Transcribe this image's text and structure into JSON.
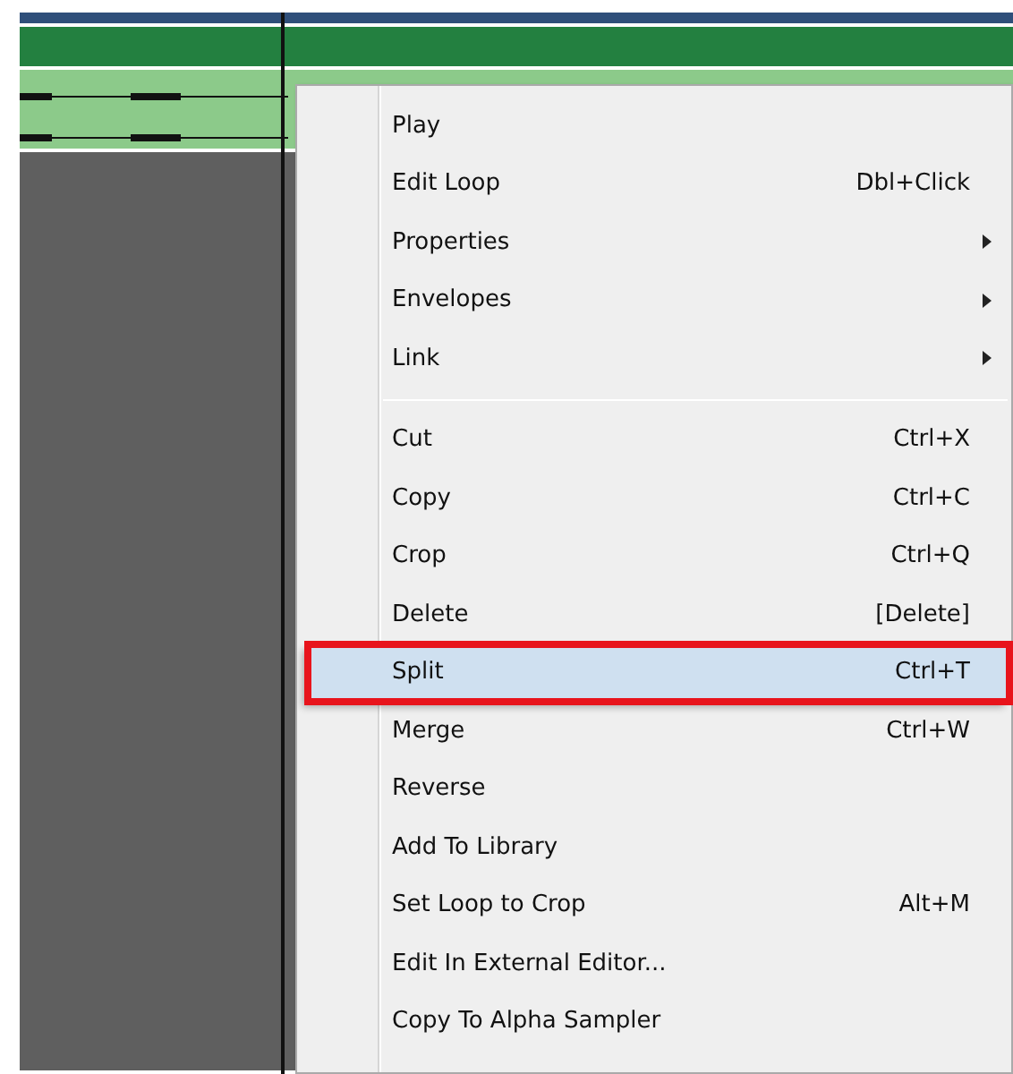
{
  "context_menu": {
    "items": [
      {
        "kind": "item",
        "label": "Play",
        "selected": false
      },
      {
        "kind": "item",
        "label": "Edit Loop",
        "shortcut": "Dbl+Click",
        "selected": false
      },
      {
        "kind": "item",
        "label": "Properties",
        "submenu": true,
        "selected": false
      },
      {
        "kind": "item",
        "label": "Envelopes",
        "submenu": true,
        "selected": false
      },
      {
        "kind": "item",
        "label": "Link",
        "submenu": true,
        "selected": false
      },
      {
        "kind": "separator"
      },
      {
        "kind": "item",
        "label": "Cut",
        "shortcut": "Ctrl+X",
        "selected": false
      },
      {
        "kind": "item",
        "label": "Copy",
        "shortcut": "Ctrl+C",
        "selected": false
      },
      {
        "kind": "item",
        "label": "Crop",
        "shortcut": "Ctrl+Q",
        "selected": false
      },
      {
        "kind": "item",
        "label": "Delete",
        "shortcut": "[Delete]",
        "selected": false
      },
      {
        "kind": "item",
        "label": "Split",
        "shortcut": "Ctrl+T",
        "selected": true
      },
      {
        "kind": "item",
        "label": "Merge",
        "shortcut": "Ctrl+W",
        "selected": false
      },
      {
        "kind": "item",
        "label": "Reverse",
        "selected": false
      },
      {
        "kind": "item",
        "label": "Add To Library",
        "selected": false
      },
      {
        "kind": "item",
        "label": "Set Loop to Crop",
        "shortcut": "Alt+M",
        "selected": false
      },
      {
        "kind": "item",
        "label": "Edit In External Editor...",
        "selected": false
      },
      {
        "kind": "item",
        "label": "Copy To Alpha Sampler",
        "selected": false
      }
    ]
  }
}
